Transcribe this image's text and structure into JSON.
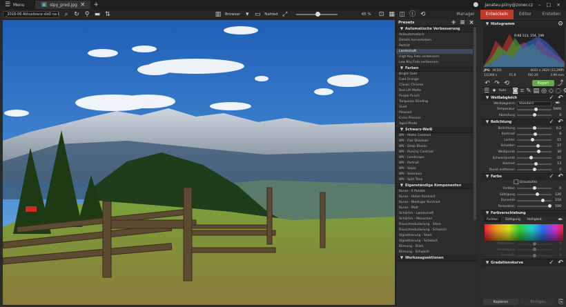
{
  "titlebar": {
    "menu_label": "Menu",
    "file_tab": "slpy_pred.jpg",
    "account": "janateu.piiny@zoner.cz"
  },
  "toolbar": {
    "path": "_2018-06 Aktualizace sloD na Konv",
    "browser": "Browser",
    "preview": "Nahled",
    "zoom": "45 %"
  },
  "modes": [
    {
      "label": "Manager"
    },
    {
      "label": "Entwickeln"
    },
    {
      "label": "Editor"
    },
    {
      "label": "Erstellen"
    }
  ],
  "presets": {
    "title": "Presets",
    "groups": [
      {
        "name": "Automatische Verbesserung",
        "items": [
          "Vollautomatisch",
          "Details hervorheben",
          "Porträt",
          "Landschaft",
          "High Key Foto verbessern",
          "Low Key Foto verbessern"
        ]
      },
      {
        "name": "Farben",
        "items": [
          "Bright Gold",
          "Cold Orange",
          "Classic Chrome",
          "Red Lift Matte",
          "Purple Punch",
          "Turquoise Shading",
          "Vivid",
          "Polaroid",
          "Cross Process",
          "Aged Photo"
        ]
      },
      {
        "name": "Schwarz-Weiß",
        "items": [
          "BW - Matte Contrast",
          "BW - Flat Shadows",
          "BW - Deep Blacks",
          "BW - Punchy Contrast",
          "BW - Landscape",
          "BW - Portrait",
          "BW - Sepia",
          "BW - Selenium",
          "BW - Split Tone"
        ]
      },
      {
        "name": "Eigenständige Komponenten",
        "items": [
          "Kurve - S Punkte",
          "Kurve - Hoher Kontrast",
          "Kurve - Niedriger Kontrast",
          "Kurve - Matt",
          "Schärfen - Landschaft",
          "Schärfen - Menschen",
          "Rauschreduzierung - Stark",
          "Rauschreduzierung - Schwach",
          "Vignettierung - Stark",
          "Vignettierung - Schwach",
          "Körnung - Stark",
          "Körnung - Schwach"
        ]
      },
      {
        "name": "Werkzeugsektionen",
        "items": []
      }
    ],
    "selected": "Landschaft"
  },
  "histogram": {
    "title": "Histogramm",
    "rgb": "R:98 113, 154, 198",
    "format": "JPG",
    "index": "(8/10)",
    "dims": "4032 x 3024 (12,2MP)",
    "shutter": "1/2300 s",
    "aperture": "F1.8",
    "iso": "ISO 20",
    "focal": "3.99 mm"
  },
  "tools": {
    "auto": "Auto",
    "export": "Export"
  },
  "whitebalance": {
    "title": "Weißabgleich",
    "mode_label": "Weißabgleich",
    "mode_value": "Standard",
    "rows": [
      {
        "label": "Temperatur",
        "value": "5600",
        "pos": 0.55
      },
      {
        "label": "Abstufung",
        "value": "0",
        "pos": 0.5
      }
    ]
  },
  "exposure": {
    "title": "Belichtung",
    "rows": [
      {
        "label": "Belichtung",
        "value": "0,2",
        "pos": 0.52
      },
      {
        "label": "Kontrast",
        "value": "8",
        "pos": 0.54
      },
      {
        "label": "Lichter",
        "value": "-15",
        "pos": 0.45
      },
      {
        "label": "Schatten",
        "value": "27",
        "pos": 0.63
      },
      {
        "label": "Weißpunkt",
        "value": "30",
        "pos": 0.65
      },
      {
        "label": "Schwarzpunkt",
        "value": "-22",
        "pos": 0.4
      },
      {
        "label": "Klarheit",
        "value": "13",
        "pos": 0.56
      },
      {
        "label": "Dunst entfernen",
        "value": "0",
        "pos": 0.5
      }
    ]
  },
  "color": {
    "title": "Farbe",
    "gray_label": "Graustufen",
    "rows": [
      {
        "label": "Farbton",
        "value": "0",
        "pos": 0.5
      },
      {
        "label": "Sättigung",
        "value": "120",
        "pos": 0.6
      },
      {
        "label": "Dynamik",
        "value": "154",
        "pos": 0.77
      },
      {
        "label": "Relaxation",
        "value": "100",
        "pos": 1.0
      }
    ]
  },
  "shift": {
    "title": "Farbverschiebung",
    "tabs": [
      "Farbton",
      "Sättigung",
      "Helligkeit"
    ],
    "rows": [
      {
        "label": "Rotationen",
        "value": "0"
      },
      {
        "label": "Verbiegung",
        "value": "0"
      },
      {
        "label": "Schwelle",
        "value": "0"
      }
    ]
  },
  "gradient": {
    "title": "Gradationskurve"
  },
  "footer": {
    "copy": "Kopieren",
    "paste": "Einfügen"
  },
  "colors": {
    "accent": "#c0392b",
    "export": "#6aa84f",
    "selection": "#3b4a5c"
  }
}
